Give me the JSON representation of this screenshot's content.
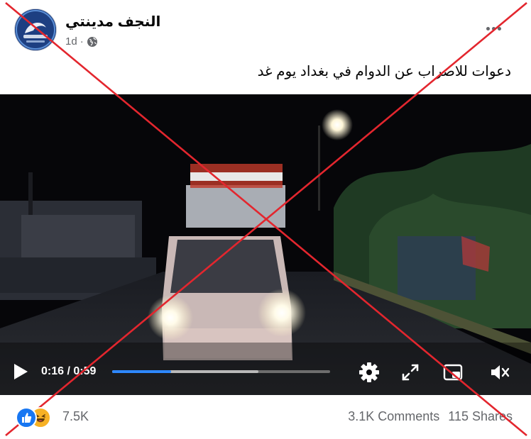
{
  "post": {
    "page_name": "النجف مدينتي",
    "timestamp": "1d",
    "audience_icon": "globe-icon",
    "more_icon": "more-options-icon",
    "text": "دعوات للاضراب عن الدوام في بغداد يوم غد"
  },
  "video": {
    "current_time": "0:16",
    "separator": "/",
    "duration": "0:59",
    "progress": 0.27,
    "buffered": 0.67,
    "icons": [
      "play-icon",
      "settings-icon",
      "fullscreen-icon",
      "picture-in-picture-icon",
      "mute-icon"
    ]
  },
  "engagement": {
    "reactions": [
      "like-icon",
      "haha-icon"
    ],
    "reaction_count": "7.5K",
    "comments": "3.1K Comments",
    "shares": "115 Shares"
  },
  "colors": {
    "accent": "#2d88ff",
    "cross": "#e3262e",
    "text_secondary": "#65676b"
  }
}
